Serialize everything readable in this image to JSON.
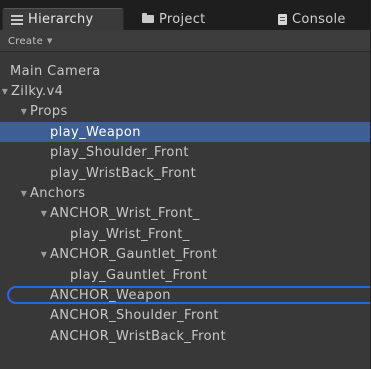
{
  "tabs": {
    "hierarchy": "Hierarchy",
    "project": "Project",
    "console": "Console"
  },
  "toolbar": {
    "create_label": "Create"
  },
  "tree": [
    {
      "label": "Main Camera",
      "depth": 0,
      "arrow": "none",
      "selected": false
    },
    {
      "label": "Zilky.v4",
      "depth": 0,
      "arrow": "expanded",
      "selected": false
    },
    {
      "label": "Props",
      "depth": 1,
      "arrow": "expanded",
      "selected": false
    },
    {
      "label": "play_Weapon",
      "depth": 2,
      "arrow": "none",
      "selected": true
    },
    {
      "label": "play_Shoulder_Front",
      "depth": 2,
      "arrow": "none",
      "selected": false
    },
    {
      "label": "play_WristBack_Front",
      "depth": 2,
      "arrow": "none",
      "selected": false
    },
    {
      "label": "Anchors",
      "depth": 1,
      "arrow": "expanded",
      "selected": false
    },
    {
      "label": "ANCHOR_Wrist_Front_",
      "depth": 2,
      "arrow": "expanded",
      "selected": false
    },
    {
      "label": "play_Wrist_Front_",
      "depth": 3,
      "arrow": "none",
      "selected": false
    },
    {
      "label": "ANCHOR_Gauntlet_Front",
      "depth": 2,
      "arrow": "expanded",
      "selected": false
    },
    {
      "label": "play_Gauntlet_Front",
      "depth": 3,
      "arrow": "none",
      "selected": false
    },
    {
      "label": "ANCHOR_Weapon",
      "depth": 2,
      "arrow": "none",
      "selected": false
    },
    {
      "label": "ANCHOR_Shoulder_Front",
      "depth": 2,
      "arrow": "none",
      "selected": false
    },
    {
      "label": "ANCHOR_WristBack_Front",
      "depth": 2,
      "arrow": "none",
      "selected": false
    }
  ],
  "colors": {
    "panel_bg": "#383838",
    "selection": "#3e5f96",
    "focus_ring": "#2f64e0"
  },
  "icons": {
    "hierarchy_tab": "list-icon",
    "project_tab": "folder-icon",
    "console_tab": "console-icon",
    "create_caret": "chevron-down-icon",
    "expand_arrow": "triangle-down-icon"
  }
}
